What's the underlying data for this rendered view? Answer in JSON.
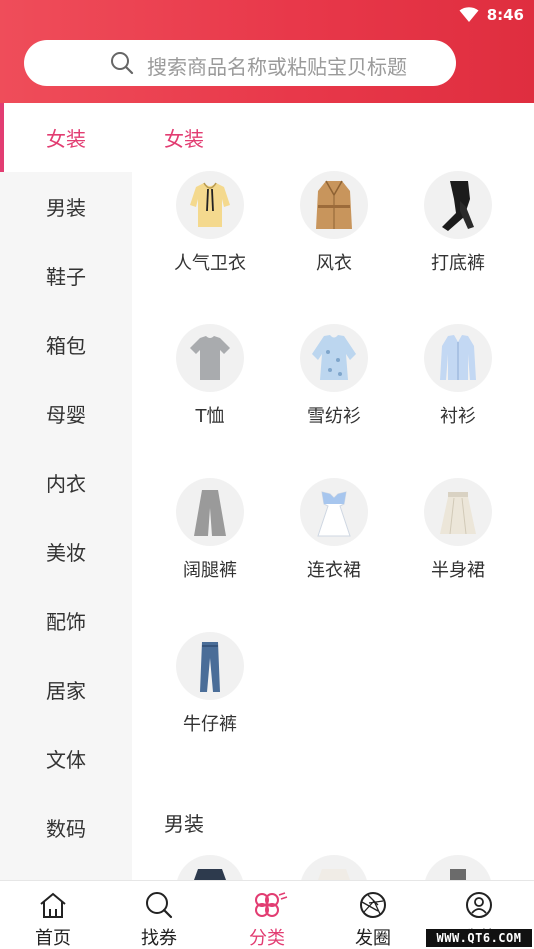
{
  "status_bar": {
    "time": "8:46"
  },
  "search": {
    "placeholder": "搜索商品名称或粘贴宝贝标题"
  },
  "sidebar": {
    "items": [
      {
        "label": "女装",
        "active": true
      },
      {
        "label": "男装"
      },
      {
        "label": "鞋子"
      },
      {
        "label": "箱包"
      },
      {
        "label": "母婴"
      },
      {
        "label": "内衣"
      },
      {
        "label": "美妆"
      },
      {
        "label": "配饰"
      },
      {
        "label": "居家"
      },
      {
        "label": "文体"
      },
      {
        "label": "数码"
      }
    ]
  },
  "sections": [
    {
      "title": "女装",
      "items": [
        {
          "label": "人气卫衣",
          "icon": "hoodie-icon"
        },
        {
          "label": "风衣",
          "icon": "trench-coat-icon"
        },
        {
          "label": "打底裤",
          "icon": "leggings-icon"
        },
        {
          "label": "T恤",
          "icon": "tshirt-icon"
        },
        {
          "label": "雪纺衫",
          "icon": "chiffon-shirt-icon"
        },
        {
          "label": "衬衫",
          "icon": "shirt-icon"
        },
        {
          "label": "阔腿裤",
          "icon": "wide-leg-pants-icon"
        },
        {
          "label": "连衣裙",
          "icon": "dress-icon"
        },
        {
          "label": "半身裙",
          "icon": "skirt-icon"
        },
        {
          "label": "牛仔裤",
          "icon": "jeans-icon"
        }
      ]
    },
    {
      "title": "男装",
      "items": []
    }
  ],
  "tabbar": {
    "items": [
      {
        "label": "首页",
        "icon": "home-icon"
      },
      {
        "label": "找券",
        "icon": "search-coupon-icon"
      },
      {
        "label": "分类",
        "icon": "category-flower-icon",
        "active": true
      },
      {
        "label": "发圈",
        "icon": "aperture-icon"
      },
      {
        "label": "我的",
        "icon": "user-icon"
      }
    ]
  },
  "watermark": "WWW.QT6.COM",
  "colors": {
    "header": "#e8384a",
    "accent": "#e23d72"
  }
}
